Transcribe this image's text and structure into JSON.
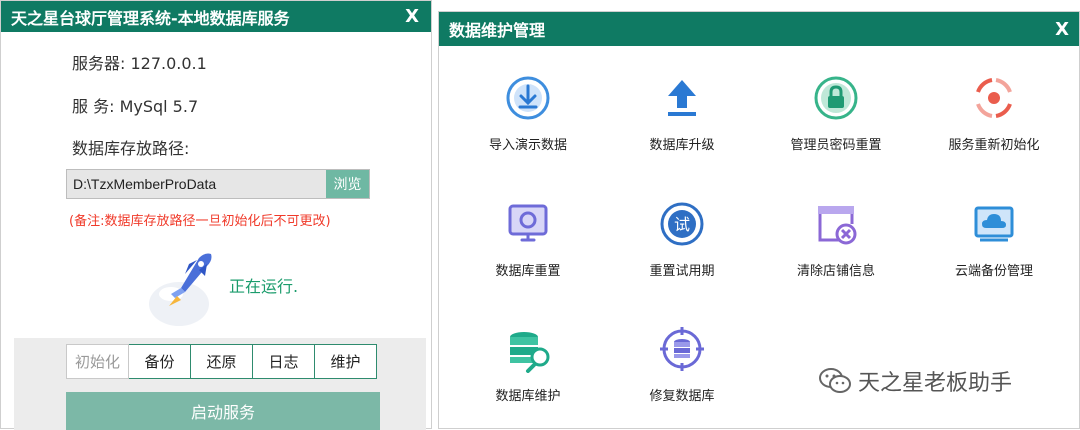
{
  "left": {
    "title": "天之星台球厅管理系统-本地数据库服务",
    "close": "X",
    "server_label": "服务器:  127.0.0.1",
    "service_label": "服 务:  MySql 5.7",
    "path_label": "数据库存放路径:",
    "path_value": "D:\\TzxMemberProData",
    "browse": "浏览",
    "note": "(备注:数据库存放路径一旦初始化后不可更改)",
    "status": "正在运行.",
    "buttons": [
      "初始化",
      "备份",
      "还原",
      "日志",
      "维护"
    ],
    "start": "启动服务"
  },
  "right": {
    "title": "数据维护管理",
    "close": "X",
    "tiles": [
      {
        "label": "导入演示数据",
        "icon": "import-demo-icon",
        "color": "#3e8ede"
      },
      {
        "label": "数据库升级",
        "icon": "upload-arrow-icon",
        "color": "#2a79d3"
      },
      {
        "label": "管理员密码重置",
        "icon": "lock-icon",
        "color": "#37b48a"
      },
      {
        "label": "服务重新初始化",
        "icon": "reset-target-icon",
        "color": "#ea5d4d"
      },
      {
        "label": "数据库重置",
        "icon": "monitor-reset-icon",
        "color": "#6e6bd8"
      },
      {
        "label": "重置试用期",
        "icon": "trial-badge-icon",
        "color": "#2f6fc4"
      },
      {
        "label": "清除店铺信息",
        "icon": "shop-clear-icon",
        "color": "#8b68d6"
      },
      {
        "label": "云端备份管理",
        "icon": "cloud-backup-icon",
        "color": "#2e8ed8"
      },
      {
        "label": "数据库维护",
        "icon": "db-wrench-icon",
        "color": "#1faa8a"
      },
      {
        "label": "修复数据库",
        "icon": "db-repair-icon",
        "color": "#6a69d6"
      }
    ]
  },
  "watermark": "天之星老板助手"
}
